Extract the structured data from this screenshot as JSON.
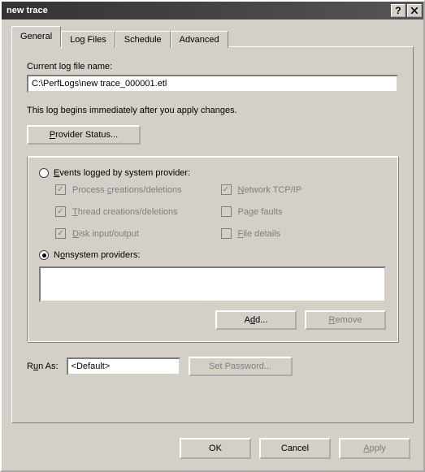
{
  "window": {
    "title": "new trace"
  },
  "tabs": {
    "items": [
      {
        "label": "General"
      },
      {
        "label": "Log Files"
      },
      {
        "label": "Schedule"
      },
      {
        "label": "Advanced"
      }
    ]
  },
  "general": {
    "currentLogLabel": "Current log file name:",
    "currentLogValue": "C:\\PerfLogs\\new trace_000001.etl",
    "note": "This log begins immediately after you apply changes.",
    "providerStatusBtn": "Provider Status...",
    "eventsRadio": "Events logged by system provider:",
    "checks": {
      "process": "Process creations/deletions",
      "thread": "Thread creations/deletions",
      "disk": "Disk input/output",
      "network": "Network TCP/IP",
      "pagefaults": "Page faults",
      "filedetails": "File details"
    },
    "nonsystemRadio": "Nonsystem providers:",
    "addBtn": "Add...",
    "removeBtn": "Remove",
    "runAsLabel": "Run As:",
    "runAsValue": "<Default>",
    "setPasswordBtn": "Set Password..."
  },
  "footer": {
    "ok": "OK",
    "cancel": "Cancel",
    "apply": "Apply"
  }
}
